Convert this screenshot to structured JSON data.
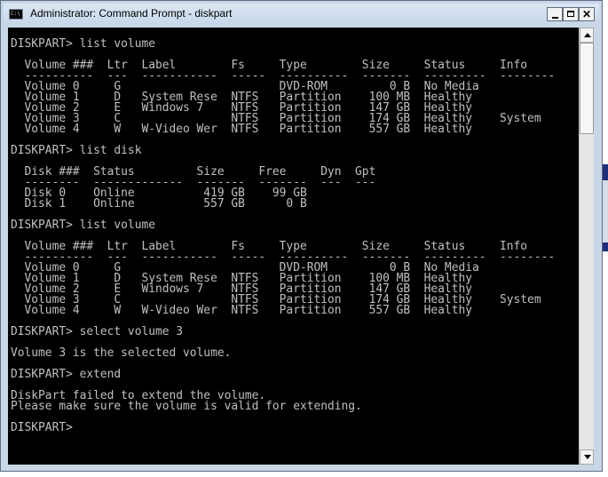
{
  "window": {
    "title": "Administrator: Command Prompt - diskpart",
    "icon": "console-icon",
    "icon_glyph": "C:\\",
    "controls": {
      "minimize": "minimize-icon",
      "maximize": "maximize-icon",
      "close": "close-icon",
      "close_glyph": "✕"
    }
  },
  "colors": {
    "console_background": "#000000",
    "console_text": "#c0c0c0",
    "title_bar": "#c9d6e6",
    "background_strip_dark": "#1f2d7a",
    "background_strip_light": "#d6dde8"
  },
  "console": {
    "lines": [
      "DISKPART> list volume",
      "",
      "  Volume ###  Ltr  Label        Fs     Type        Size     Status     Info",
      "  ----------  ---  -----------  -----  ----------  -------  ---------  --------",
      "  Volume 0     G                       DVD-ROM         0 B  No Media",
      "  Volume 1     D   System Rese  NTFS   Partition    100 MB  Healthy",
      "  Volume 2     E   Windows 7    NTFS   Partition    147 GB  Healthy",
      "  Volume 3     C                NTFS   Partition    174 GB  Healthy    System",
      "  Volume 4     W   W-Video Wer  NTFS   Partition    557 GB  Healthy",
      "",
      "DISKPART> list disk",
      "",
      "  Disk ###  Status         Size     Free     Dyn  Gpt",
      "  --------  -------------  -------  -------  ---  ---",
      "  Disk 0    Online          419 GB    99 GB",
      "  Disk 1    Online          557 GB      0 B",
      "",
      "DISKPART> list volume",
      "",
      "  Volume ###  Ltr  Label        Fs     Type        Size     Status     Info",
      "  ----------  ---  -----------  -----  ----------  -------  ---------  --------",
      "  Volume 0     G                       DVD-ROM         0 B  No Media",
      "  Volume 1     D   System Rese  NTFS   Partition    100 MB  Healthy",
      "  Volume 2     E   Windows 7    NTFS   Partition    147 GB  Healthy",
      "  Volume 3     C                NTFS   Partition    174 GB  Healthy    System",
      "  Volume 4     W   W-Video Wer  NTFS   Partition    557 GB  Healthy",
      "",
      "DISKPART> select volume 3",
      "",
      "Volume 3 is the selected volume.",
      "",
      "DISKPART> extend",
      "",
      "DiskPart failed to extend the volume.",
      "Please make sure the volume is valid for extending.",
      "",
      "DISKPART> "
    ]
  },
  "scrollbar": {
    "up_icon": "scroll-up-arrow-icon",
    "down_icon": "scroll-down-arrow-icon"
  }
}
